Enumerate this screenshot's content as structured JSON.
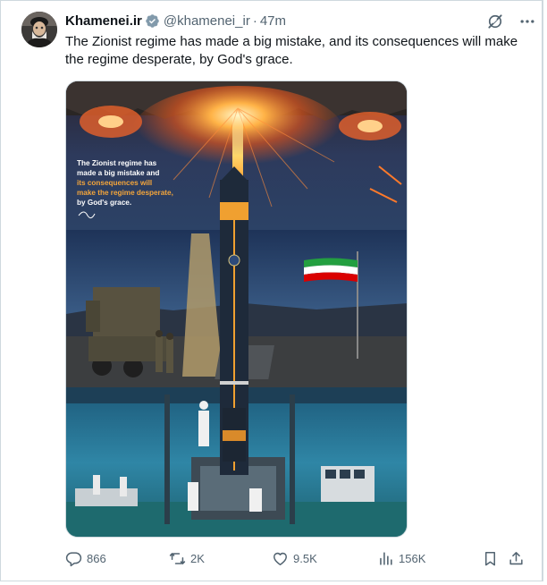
{
  "author": {
    "name": "Khamenei.ir",
    "handle": "@khamenei_ir",
    "separator": "·",
    "time": "47m"
  },
  "tweet": {
    "text": "The Zionist regime has made a big mistake, and its consequences will make the regime desperate, by God's grace."
  },
  "media": {
    "quote_line1": "The Zionist regime has",
    "quote_line2": "made a big mistake and",
    "quote_line3": "its consequences will",
    "quote_line4": "make the regime desperate,",
    "quote_line5": "by God's grace."
  },
  "actions": {
    "replies": "866",
    "reposts": "2K",
    "likes": "9.5K",
    "views": "156K"
  },
  "icons": {
    "verified": "verified-badge-icon",
    "grok": "grok-icon",
    "more": "more-icon",
    "reply": "reply-icon",
    "repost": "repost-icon",
    "like": "heart-icon",
    "views": "views-icon",
    "bookmark": "bookmark-icon",
    "share": "share-icon"
  },
  "colors": {
    "text": "#0f1419",
    "muted": "#536471",
    "verified": "#829aab",
    "border": "#cfd9de",
    "accent_orange": "#f3a53b"
  }
}
